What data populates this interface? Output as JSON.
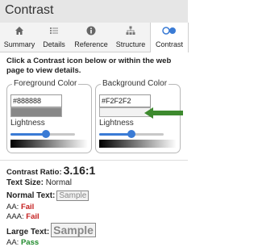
{
  "window": {
    "title": "Contrast"
  },
  "tabs": [
    {
      "label": "Summary",
      "icon": "home-icon",
      "active": false
    },
    {
      "label": "Details",
      "icon": "list-icon",
      "active": false
    },
    {
      "label": "Reference",
      "icon": "info-icon",
      "active": false
    },
    {
      "label": "Structure",
      "icon": "structure-icon",
      "active": false
    },
    {
      "label": "Contrast",
      "icon": "contrast-icon",
      "active": true
    }
  ],
  "instructions": "Click a Contrast icon below or within the web page to view details.",
  "foreground": {
    "legend": "Foreground Color",
    "hex": "#888888",
    "lightness_label": "Lightness",
    "lightness": 0.55
  },
  "background": {
    "legend": "Background Color",
    "hex": "#F2F2F2",
    "lightness_label": "Lightness",
    "lightness": 0.5
  },
  "colors": {
    "accent": "#3a7bd5",
    "arrow": "#3d8a2e",
    "fail": "#c41e1e",
    "pass": "#1f8a2b"
  },
  "results": {
    "ratio_label": "Contrast Ratio:",
    "ratio_value": "3.16:1",
    "text_size_label": "Text Size:",
    "text_size_value": "Normal",
    "normal_text_label": "Normal Text:",
    "sample_text": "Sample",
    "normal_aa_label": "AA:",
    "normal_aa_value": "Fail",
    "normal_aaa_label": "AAA:",
    "normal_aaa_value": "Fail",
    "large_text_label": "Large Text:",
    "large_sample_text": "Sample",
    "large_aa_label": "AA:",
    "large_aa_value": "Pass"
  }
}
